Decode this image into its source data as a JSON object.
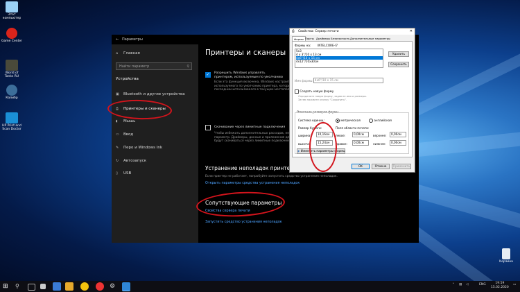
{
  "desktop": {
    "icons": [
      {
        "label": "Этот компьютер",
        "icon": "computer-icon",
        "color": "#9ad0f5"
      },
      {
        "label": "Game Center",
        "icon": "game-center-icon",
        "color": "#d9241b"
      },
      {
        "label": "World of Tanks RU",
        "icon": "world-of-tanks-icon",
        "color": "#4a4a3a"
      },
      {
        "label": "Калибр",
        "icon": "kalibr-icon",
        "color": "#3c6e9a"
      },
      {
        "label": "HP Print and Scan Doctor",
        "icon": "hp-doctor-icon",
        "color": "#1a8fd6"
      }
    ],
    "recycle_bin": {
      "label": "Корзина",
      "icon": "recycle-bin-icon"
    }
  },
  "settings": {
    "title": "Параметры",
    "nav": {
      "home": "Главная",
      "search_placeholder": "Найти параметр",
      "section": "Устройства",
      "items": [
        {
          "label": "Bluetooth и другие устройства",
          "icon": "bluetooth-icon"
        },
        {
          "label": "Принтеры и сканеры",
          "icon": "printer-icon"
        },
        {
          "label": "Мышь",
          "icon": "mouse-icon"
        },
        {
          "label": "Ввод",
          "icon": "keyboard-icon"
        },
        {
          "label": "Перо и Windows Ink",
          "icon": "pen-icon"
        },
        {
          "label": "Автозапуск",
          "icon": "autoplay-icon"
        },
        {
          "label": "USB",
          "icon": "usb-icon"
        }
      ]
    },
    "main": {
      "heading": "Принтеры и сканеры",
      "default_printer_checkbox": "Разрешить Windows управлять принтером, используемым по умолчанию",
      "default_printer_desc": [
        "Если эта функция включена, Windows настроит в качестве",
        "используемого по умолчанию принтера, который",
        "последним использовался в текущем местоположении."
      ],
      "metered_checkbox": "Скачивание через лимитные подключения",
      "metered_desc": [
        "Чтобы избежать дополнительных расходов, не включайте этот",
        "параметр. Драйверы, данные и приложения для новых устройств",
        "будут скачиваться через лимитные подключения к Интернету."
      ],
      "troubleshoot_heading": "Устранение неполадок принтера",
      "troubleshoot_desc": "Если принтер не работает, попробуйте запустить средство устранения неполадок.",
      "troubleshoot_link": "Открыть параметры средства устранения неполадок",
      "related_heading": "Сопутствующие параметры",
      "related_links": [
        "Свойства сервера печати",
        "Запустить средство устранения неполадок"
      ]
    }
  },
  "dialog": {
    "title": "Свойства: Сервер печати",
    "tabs": [
      "Формы",
      "Порты",
      "Драйверы",
      "Безопасность",
      "Дополнительные параметры"
    ],
    "forms_on_label": "Формы на:",
    "forms_on_value": "INTELCORE-I7",
    "form_list": [
      "5x3",
      "4 x 3\"/10 x 13 см",
      "4x6\"/10 x 15 см",
      "4x12\"/10x30см"
    ],
    "selected_index": 2,
    "delete_button": "Удалить",
    "save_button": "Сохранить",
    "form_name_label": "Имя формы:",
    "form_name_value": "4x6\"/10 x 15 см",
    "create_new_checkbox": "Создать новую форму",
    "create_hint": [
      "Определите новую форму, задав ее имя и размеры.",
      "Затем нажмите кнопку \"Сохранить\"."
    ],
    "description_group": "Описание размеров формы",
    "units_label": "Система единиц:",
    "unit_metric": "метрическая",
    "unit_english": "английская",
    "paper_size_label": "Размер бумаги:",
    "margins_label": "Поля области печати:",
    "width_label": "ширина:",
    "width_value": "10,16см",
    "height_label": "высота:",
    "height_value": "15,24см",
    "left_label": "левое:",
    "left_value": "0,00см",
    "right_label": "правое:",
    "right_value": "0,00см",
    "top_label": "верхнее:",
    "top_value": "0,00см",
    "bottom_label": "нижнее:",
    "bottom_value": "0,00см",
    "change_settings_button": "Изменить параметры формы",
    "ok_button": "OK",
    "cancel_button": "Отмена",
    "apply_button": "Применить"
  },
  "taskbar": {
    "lang": "ENG",
    "time": "19:59",
    "date": "15.02.2020"
  },
  "colors": {
    "accent": "#0078d7",
    "link": "#4da3ff",
    "annotation": "#d3141c"
  }
}
